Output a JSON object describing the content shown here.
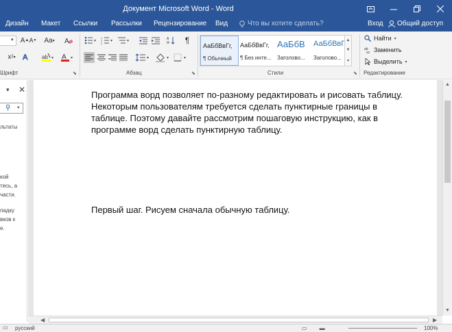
{
  "window": {
    "title": "Документ Microsoft Word - Word"
  },
  "tabs": [
    "Дизайн",
    "Макет",
    "Ссылки",
    "Рассылки",
    "Рецензирование",
    "Вид"
  ],
  "tell_me": "Что вы хотите сделать?",
  "signin": "Вход",
  "share": "Общий доступ",
  "ribbon": {
    "font_group": "Шрифт",
    "para_group": "Абзац",
    "styles_group": "Стили",
    "edit_group": "Редактирование",
    "case_button": "Aa",
    "styles": [
      {
        "sample": "АаБбВвГг,",
        "name": "¶ Обычный"
      },
      {
        "sample": "АаБбВвГг,",
        "name": "¶ Без инте..."
      },
      {
        "sample": "АаБбВ",
        "name": "Заголово..."
      },
      {
        "sample": "АаБбВвГ",
        "name": "Заголово..."
      }
    ],
    "edit": {
      "find": "Найти",
      "replace": "Заменить",
      "select": "Выделить"
    }
  },
  "navpane": {
    "fragments": [
      "льтаты",
      "кой",
      "тесь, а",
      "части.",
      "падку",
      "вков к",
      "е."
    ]
  },
  "document": {
    "para1": [
      "Программа ворд позволяет по-разному редактировать и рисовать таблицу.",
      "Некоторым пользователям требуется сделать пунктирные границы в",
      "таблице. Поэтому давайте рассмотрим пошаговую инструкцию, как в",
      "программе ворд сделать пунктирную таблицу."
    ],
    "para2": "Первый шаг. Рисуем сначала обычную таблицу."
  },
  "status": {
    "language": "русский",
    "zoom": "100%"
  },
  "colors": {
    "accent": "#2b579a",
    "style_heading": "#2e74b5"
  }
}
